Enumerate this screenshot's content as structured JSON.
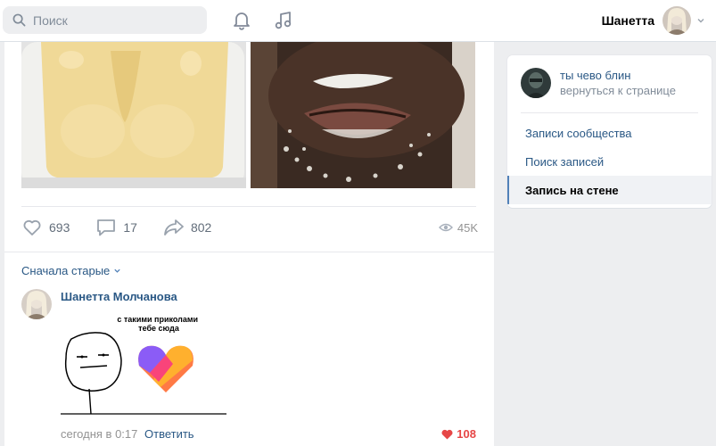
{
  "header": {
    "search_placeholder": "Поиск",
    "icons": [
      "search-icon",
      "bell-icon",
      "music-icon",
      "chevron-down-icon"
    ],
    "user_name": "Шанетта"
  },
  "post": {
    "likes": "693",
    "comments": "17",
    "shares": "802",
    "views": "45K",
    "sort_label": "Сначала старые",
    "comment": {
      "author": "Шанетта Молчанова",
      "sticker_text": "с такими приколами\nтебе сюда",
      "time": "сегодня в 0:17",
      "reply_label": "Ответить",
      "likes": "108"
    }
  },
  "right_menu": {
    "title": "ты чево блин",
    "subtitle": "вернуться к странице",
    "items": [
      {
        "label": "Записи сообщества",
        "active": false
      },
      {
        "label": "Поиск записей",
        "active": false
      },
      {
        "label": "Запись на стене",
        "active": true
      }
    ]
  },
  "colors": {
    "link": "#2a5885",
    "accent": "#5181b8",
    "like_red": "#e64646",
    "page_bg": "#edeef0"
  }
}
